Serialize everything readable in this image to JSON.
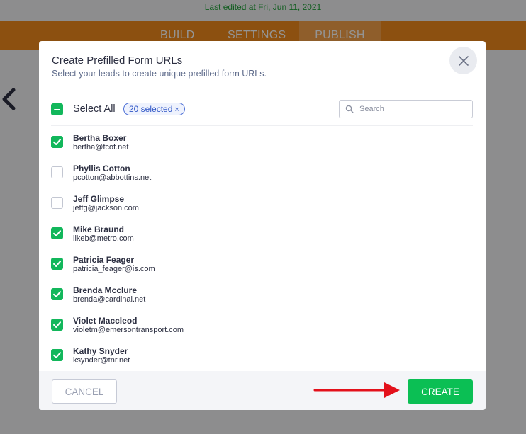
{
  "app": {
    "last_edited": "Last edited at Fri, Jun 11, 2021",
    "nav": {
      "build": "BUILD",
      "settings": "SETTINGS",
      "publish": "PUBLISH"
    }
  },
  "modal": {
    "title": "Create Prefilled Form URLs",
    "subtitle": "Select your leads to create unique prefilled form URLs.",
    "select_all_label": "Select All",
    "selected_badge": "20 selected",
    "search_placeholder": "Search",
    "leads": [
      {
        "name": "Bertha Boxer",
        "email": "bertha@fcof.net",
        "checked": true
      },
      {
        "name": "Phyllis Cotton",
        "email": "pcotton@abbottins.net",
        "checked": false
      },
      {
        "name": "Jeff Glimpse",
        "email": "jeffg@jackson.com",
        "checked": false
      },
      {
        "name": "Mike Braund",
        "email": "likeb@metro.com",
        "checked": true
      },
      {
        "name": "Patricia Feager",
        "email": "patricia_feager@is.com",
        "checked": true
      },
      {
        "name": "Brenda Mcclure",
        "email": "brenda@cardinal.net",
        "checked": true
      },
      {
        "name": "Violet Maccleod",
        "email": "violetm@emersontransport.com",
        "checked": true
      },
      {
        "name": "Kathy Snyder",
        "email": "ksynder@tnr.net",
        "checked": true
      }
    ],
    "cancel_label": "CANCEL",
    "create_label": "CREATE"
  },
  "colors": {
    "accent_green": "#12b75b",
    "brand_orange": "#f18a1c",
    "annotation_red": "#e3111b",
    "badge_blue": "#2f56c6"
  }
}
